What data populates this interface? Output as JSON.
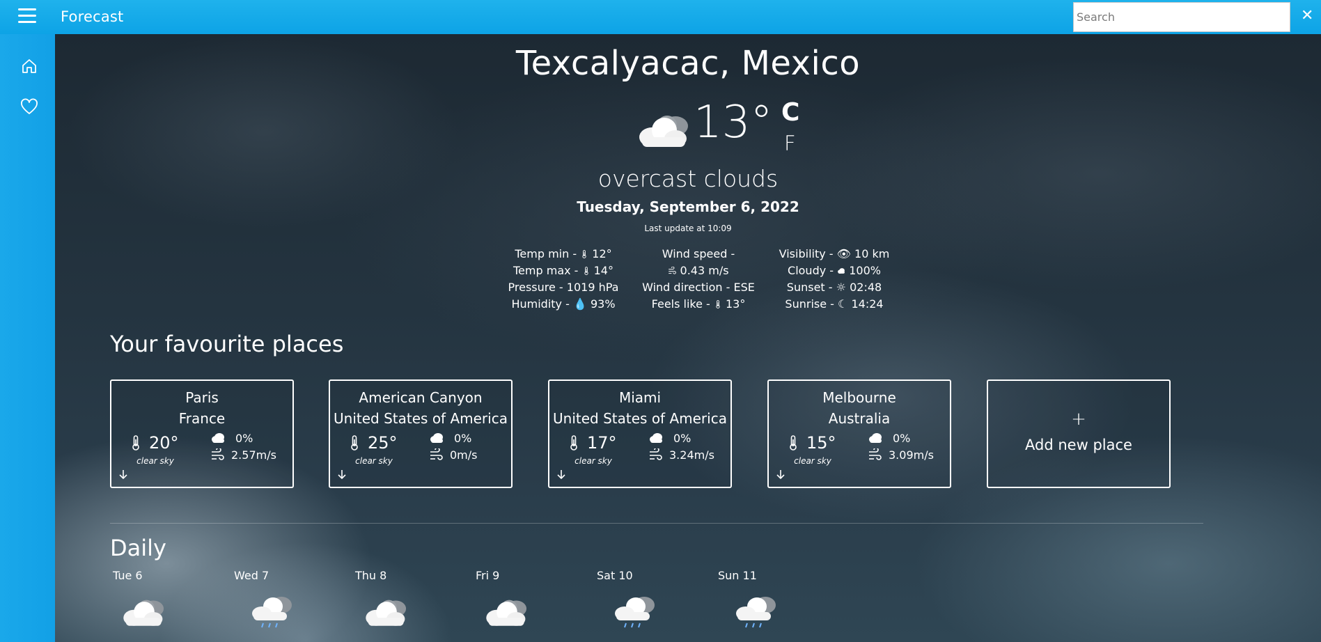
{
  "app": {
    "title": "Forecast",
    "search_placeholder": "Search",
    "close_label": "✕"
  },
  "sidebar": {
    "items": [
      {
        "icon": "home-icon"
      },
      {
        "icon": "heart-icon"
      }
    ]
  },
  "current": {
    "location": "Texcalyacac, Mexico",
    "temp": "13°",
    "unit_c": "C",
    "unit_f": "F",
    "condition": "overcast clouds",
    "date": "Tuesday, September 6, 2022",
    "last_update": "Last update at 10:09",
    "icon": "overcast-clouds-icon"
  },
  "details": {
    "col1": [
      {
        "label": "Temp min - ",
        "icon": "thermometer-icon",
        "value": "12°"
      },
      {
        "label": "Temp max - ",
        "icon": "thermometer-icon",
        "value": "14°"
      },
      {
        "label": "Pressure - 1019 hPa",
        "icon": "",
        "value": ""
      },
      {
        "label": "Humidity - ",
        "icon": "droplet-icon",
        "value": "93%"
      }
    ],
    "wind_speed_label": "Wind speed -",
    "wind_speed_value": "0.43 m/s",
    "wind_direction": "Wind direction - ESE",
    "feels_like_label": "Feels like - ",
    "feels_like_value": "13°",
    "col3": [
      {
        "label": "Visibility - ",
        "icon": "eye-icon",
        "value": "10 km"
      },
      {
        "label": "Cloudy - ",
        "icon": "cloud-icon",
        "value": "100%"
      },
      {
        "label": "Sunset - ",
        "icon": "sun-icon",
        "value": "02:48"
      },
      {
        "label": "Sunrise - ",
        "icon": "moon-icon",
        "value": "14:24"
      }
    ]
  },
  "favourites": {
    "title": "Your favourite places",
    "places": [
      {
        "city": "Paris",
        "country": "France",
        "temp": "20°",
        "desc": "clear sky",
        "cloud": "0%",
        "wind": "2.57m/s"
      },
      {
        "city": "American Canyon",
        "country": "United States of America",
        "temp": "25°",
        "desc": "clear sky",
        "cloud": "0%",
        "wind": "0m/s"
      },
      {
        "city": "Miami",
        "country": "United States of America",
        "temp": "17°",
        "desc": "clear sky",
        "cloud": "0%",
        "wind": "3.24m/s"
      },
      {
        "city": "Melbourne",
        "country": "Australia",
        "temp": "15°",
        "desc": "clear sky",
        "cloud": "0%",
        "wind": "3.09m/s"
      }
    ],
    "add_plus": "+",
    "add_label": "Add new place"
  },
  "daily": {
    "title": "Daily",
    "days": [
      {
        "name": "Tue 6",
        "icon": "overcast-clouds-icon"
      },
      {
        "name": "Wed 7",
        "icon": "light-rain-icon"
      },
      {
        "name": "Thu 8",
        "icon": "overcast-clouds-icon"
      },
      {
        "name": "Fri 9",
        "icon": "overcast-clouds-icon"
      },
      {
        "name": "Sat 10",
        "icon": "rain-icon"
      },
      {
        "name": "Sun 11",
        "icon": "rain-icon"
      }
    ]
  },
  "colors": {
    "accent": "#12a3e8",
    "text": "#ffffff"
  }
}
